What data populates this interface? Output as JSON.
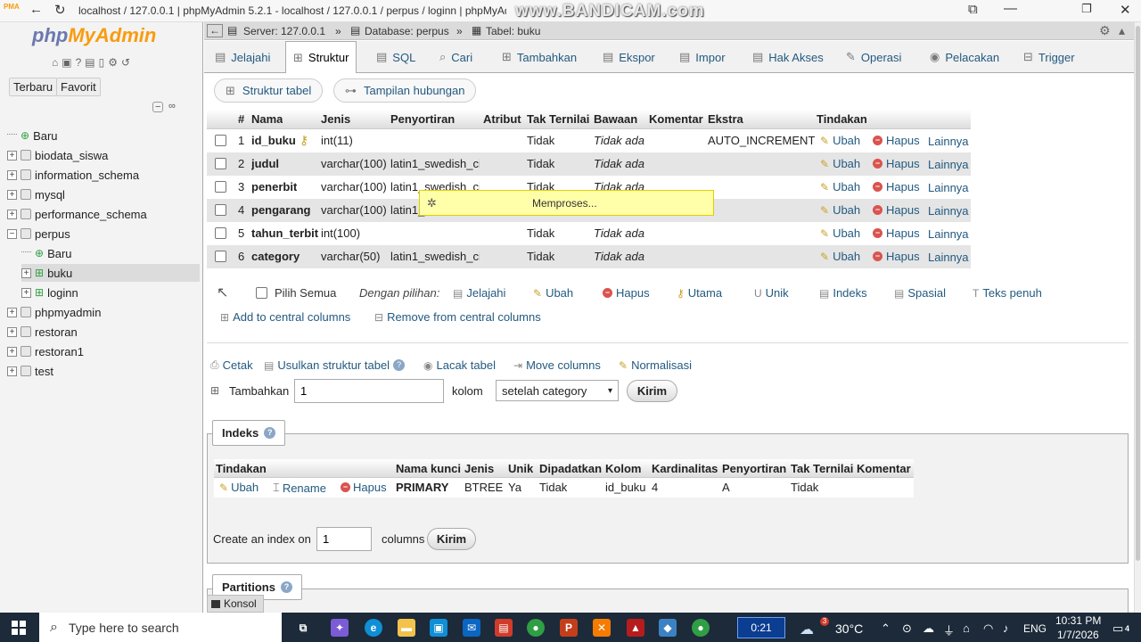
{
  "browser": {
    "tab_title": "localhost / 127.0.0.1 | phpMyAdmin 5.2.1 - localhost / 127.0.0.1 / perpus / loginn | phpMyAdmin 5.2.1",
    "watermark": "www.BANDICAM.com"
  },
  "logo": {
    "php": "php",
    "my": "MyAdmin"
  },
  "left": {
    "recent_label": "Terbaru",
    "favorite_label": "Favorit",
    "tree": [
      {
        "label": "Baru",
        "type": "new"
      },
      {
        "label": "biodata_siswa",
        "type": "db"
      },
      {
        "label": "information_schema",
        "type": "db"
      },
      {
        "label": "mysql",
        "type": "db"
      },
      {
        "label": "performance_schema",
        "type": "db"
      },
      {
        "label": "perpus",
        "type": "db-open"
      },
      {
        "label": "Baru",
        "type": "new-child"
      },
      {
        "label": "buku",
        "type": "table-child"
      },
      {
        "label": "loginn",
        "type": "table-child"
      },
      {
        "label": "phpmyadmin",
        "type": "db"
      },
      {
        "label": "restoran",
        "type": "db"
      },
      {
        "label": "restoran1",
        "type": "db"
      },
      {
        "label": "test",
        "type": "db"
      }
    ]
  },
  "breadcrumb": {
    "server": "Server: 127.0.0.1",
    "database": "Database: perpus",
    "table": "Tabel: buku"
  },
  "tabs": [
    "Jelajahi",
    "Struktur",
    "SQL",
    "Cari",
    "Tambahkan",
    "Ekspor",
    "Impor",
    "Hak Akses",
    "Operasi",
    "Pelacakan",
    "Trigger"
  ],
  "subtabs": {
    "structure": "Struktur tabel",
    "relation": "Tampilan hubungan"
  },
  "structure": {
    "headers": [
      "#",
      "Nama",
      "Jenis",
      "Penyortiran",
      "Atribut",
      "Tak Ternilai",
      "Bawaan",
      "Komentar",
      "Ekstra",
      "Tindakan"
    ],
    "rows": [
      {
        "num": "1",
        "name": "id_buku",
        "type": "int(11)",
        "collation": "",
        "null": "Tidak",
        "default": "Tidak ada",
        "extra": "AUTO_INCREMENT",
        "key": true
      },
      {
        "num": "2",
        "name": "judul",
        "type": "varchar(100)",
        "collation": "latin1_swedish_ci",
        "null": "Tidak",
        "default": "Tidak ada",
        "extra": "",
        "key": false
      },
      {
        "num": "3",
        "name": "penerbit",
        "type": "varchar(100)",
        "collation": "latin1_swedish_ci",
        "null": "Tidak",
        "default": "Tidak ada",
        "extra": "",
        "key": false
      },
      {
        "num": "4",
        "name": "pengarang",
        "type": "varchar(100)",
        "collation": "latin1_",
        "null": "",
        "default": "",
        "extra": "",
        "key": false
      },
      {
        "num": "5",
        "name": "tahun_terbit",
        "type": "int(100)",
        "collation": "",
        "null": "Tidak",
        "default": "Tidak ada",
        "extra": "",
        "key": false
      },
      {
        "num": "6",
        "name": "category",
        "type": "varchar(50)",
        "collation": "latin1_swedish_ci",
        "null": "Tidak",
        "default": "Tidak ada",
        "extra": "",
        "key": false
      }
    ],
    "actions": {
      "change": "Ubah",
      "drop": "Hapus",
      "more": "Lainnya"
    }
  },
  "processing_text": "Memproses...",
  "bulk": {
    "check_all": "Pilih Semua",
    "with_selected": "Dengan pilihan:",
    "items": [
      "Jelajahi",
      "Ubah",
      "Hapus",
      "Utama",
      "Unik",
      "Indeks",
      "Spasial",
      "Teks penuh"
    ],
    "add_central": "Add to central columns",
    "remove_central": "Remove from central columns"
  },
  "tools": {
    "print": "Cetak",
    "propose": "Usulkan struktur tabel",
    "track": "Lacak tabel",
    "move": "Move columns",
    "normalize": "Normalisasi"
  },
  "add_column": {
    "label": "Tambahkan",
    "value": "1",
    "unit": "kolom",
    "position": "setelah category",
    "submit": "Kirim"
  },
  "indexes": {
    "legend": "Indeks",
    "headers": [
      "Tindakan",
      "Nama kunci",
      "Jenis",
      "Unik",
      "Dipadatkan",
      "Kolom",
      "Kardinalitas",
      "Penyortiran",
      "Tak Ternilai",
      "Komentar"
    ],
    "row": {
      "edit": "Ubah",
      "rename": "Rename",
      "drop": "Hapus",
      "keyname": "PRIMARY",
      "type": "BTREE",
      "unique": "Ya",
      "packed": "Tidak",
      "column": "id_buku",
      "cardinality": "4",
      "collation": "A",
      "null": "Tidak",
      "comment": ""
    },
    "create_label": "Create an index on",
    "create_value": "1",
    "columns_label": "columns",
    "submit": "Kirim"
  },
  "partitions": {
    "legend": "Partitions"
  },
  "console_label": "Konsol",
  "taskbar": {
    "search_placeholder": "Type here to search",
    "timer": "0:21",
    "weather_badge": "3",
    "temperature": "30°C",
    "language": "ENG",
    "time": "10:31 PM",
    "date": "1/7/2026",
    "notif_count": "4"
  }
}
